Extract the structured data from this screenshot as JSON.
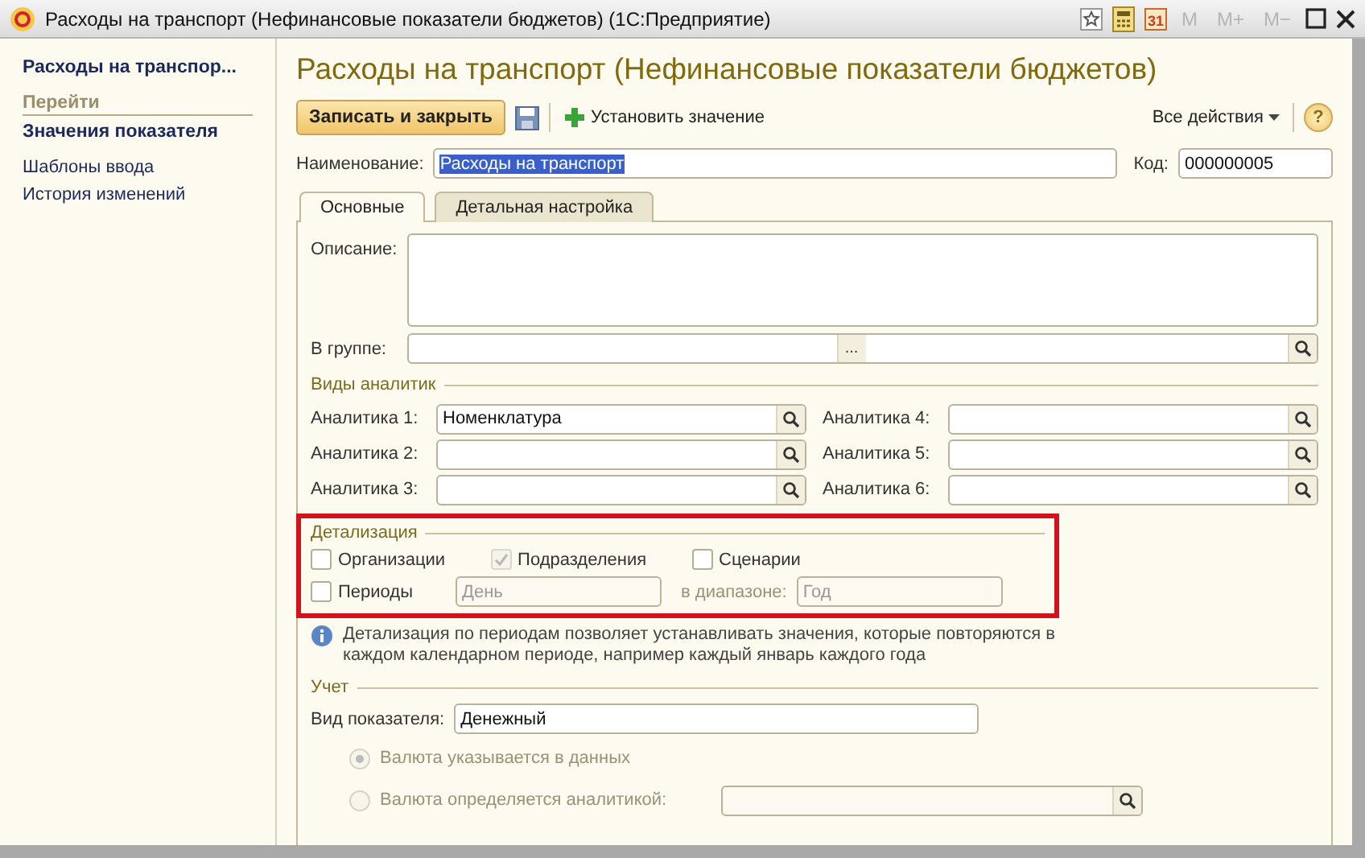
{
  "window": {
    "title": "Расходы на транспорт (Нефинансовые показатели бюджетов)  (1С:Предприятие)",
    "calendar_day": "31",
    "memory_buttons": [
      {
        "label": "M",
        "disabled": true
      },
      {
        "label": "M+",
        "disabled": true
      },
      {
        "label": "M−",
        "disabled": true
      }
    ]
  },
  "sidebar": {
    "title": "Расходы на транспор...",
    "section": "Перейти",
    "items": [
      {
        "label": "Значения показателя",
        "selected": true
      },
      {
        "label": "Шаблоны ввода",
        "selected": false
      },
      {
        "label": "История изменений",
        "selected": false
      }
    ]
  },
  "form": {
    "title": "Расходы на транспорт (Нефинансовые показатели бюджетов)",
    "toolbar": {
      "primary": "Записать и закрыть",
      "set_value": "Установить значение",
      "all_actions": "Все действия",
      "help": "?"
    },
    "name_label": "Наименование:",
    "name_value": "Расходы на транспорт",
    "code_label": "Код:",
    "code_value": "000000005",
    "tabs": [
      {
        "label": "Основные",
        "selected": true
      },
      {
        "label": "Детальная настройка",
        "selected": false
      }
    ],
    "description_label": "Описание:",
    "group_label": "В группе:",
    "group_button": "...",
    "analytics_title": "Виды аналитик",
    "analytics": [
      {
        "label": "Аналитика 1:",
        "value": "Номенклатура"
      },
      {
        "label": "Аналитика 2:"
      },
      {
        "label": "Аналитика 3:"
      },
      {
        "label": "Аналитика 4:"
      },
      {
        "label": "Аналитика 5:"
      },
      {
        "label": "Аналитика 6:"
      }
    ],
    "detail_title": "Детализация",
    "detail_checks": [
      {
        "label": "Организации",
        "checked": false,
        "disabled": false
      },
      {
        "label": "Подразделения",
        "checked": true,
        "disabled": true
      },
      {
        "label": "Сценарии",
        "checked": false,
        "disabled": false
      }
    ],
    "periods": {
      "label": "Периоды",
      "checked": false,
      "period_value": "День",
      "range_label": "в диапазоне:",
      "range_value": "Год"
    },
    "note": "Детализация по периодам позволяет устанавливать значения, которые повторяются в каждом календарном периоде, например каждый январь каждого года",
    "accounting_title": "Учет",
    "kind_label": "Вид показателя:",
    "kind_value": "Денежный",
    "currency_options": [
      {
        "kind": "plain",
        "label": "Валюта указывается в данных",
        "selected": true,
        "disabled": true
      },
      {
        "kind": "with_field",
        "label": "Валюта определяется аналитикой:",
        "selected": false,
        "disabled": true
      }
    ]
  }
}
